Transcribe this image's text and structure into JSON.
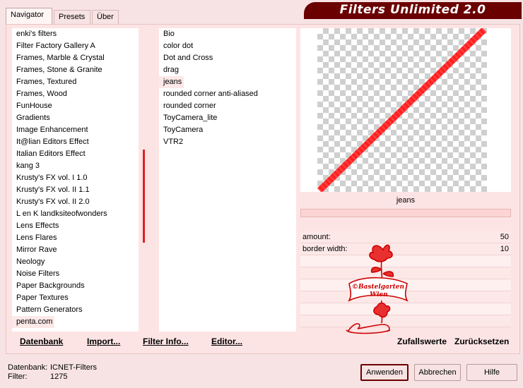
{
  "tabs": [
    "Navigator",
    "Presets",
    "Über"
  ],
  "title": "Filters Unlimited 2.0",
  "categories": [
    "enki's filters",
    "Filter Factory Gallery A",
    "Frames, Marble & Crystal",
    "Frames, Stone & Granite",
    "Frames, Textured",
    "Frames, Wood",
    "FunHouse",
    "Gradients",
    "Image Enhancement",
    "It@lian Editors Effect",
    "Italian Editors Effect",
    "kang 3",
    "Krusty's FX vol. I 1.0",
    "Krusty's FX vol. II 1.1",
    "Krusty's FX vol. II 2.0",
    "L en K landksiteofwonders",
    "Lens Effects",
    "Lens Flares",
    "Mirror Rave",
    "Neology",
    "Noise Filters",
    "Paper Backgrounds",
    "Paper Textures",
    "Pattern Generators",
    "penta.com"
  ],
  "selected_category": "penta.com",
  "filters": [
    "Bio",
    "color dot",
    "Dot and Cross",
    "drag",
    "jeans",
    "rounded corner anti-aliased",
    "rounded corner",
    "ToyCamera_lite",
    "ToyCamera",
    "VTR2"
  ],
  "selected_filter": "jeans",
  "preview_filter_name": "jeans",
  "params": [
    {
      "label": "amount:",
      "value": "50"
    },
    {
      "label": "border width:",
      "value": "10"
    }
  ],
  "toolbar": {
    "datenbank": "Datenbank",
    "import": "Import...",
    "filter_info": "Filter Info...",
    "editor": "Editor...",
    "zufallswerte": "Zufallswerte",
    "zuruecksetzen": "Zurücksetzen"
  },
  "footer": {
    "db_label": "Datenbank:",
    "db_value": "ICNET-Filters",
    "filter_label": "Filter:",
    "filter_value": "1275",
    "apply": "Anwenden",
    "cancel": "Abbrechen",
    "help": "Hilfe"
  },
  "watermark": {
    "line1": "©Bastelgarten",
    "line2": "Wien"
  },
  "colors": {
    "accent": "#6b0000",
    "highlight": "#e02020",
    "panel": "#fde4e4"
  }
}
